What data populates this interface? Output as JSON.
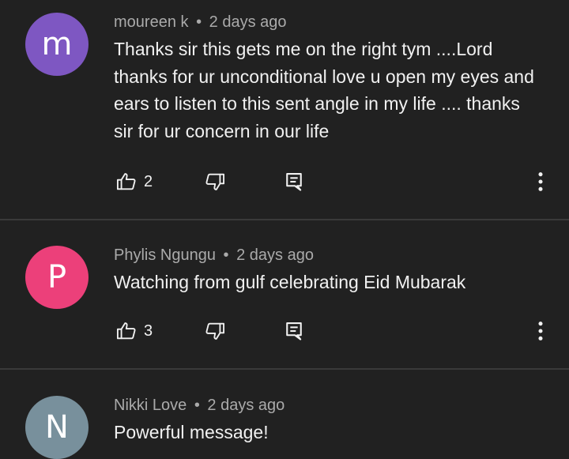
{
  "colors": {
    "background": "#212121",
    "meta_text": "#aaaaaa",
    "body_text": "#f1f1f1",
    "divider": "#3a3a3a"
  },
  "comments": [
    {
      "avatar_letter": "m",
      "avatar_color": "#7e57c2",
      "author": "moureen k",
      "separator": "•",
      "time": "2 days ago",
      "text": "Thanks sir this gets me on the right tym ....Lord thanks for ur unconditional love u open my eyes and ears to listen to this sent angle in my life .... thanks sir for ur concern in our life",
      "likes": "2",
      "icons": [
        "thumb-up-icon",
        "thumb-down-icon",
        "reply-icon",
        "more-vert-icon"
      ]
    },
    {
      "avatar_letter": "P",
      "avatar_color": "#ec407a",
      "author": "Phylis Ngungu",
      "separator": "•",
      "time": "2 days ago",
      "text": "Watching from gulf celebrating Eid Mubarak",
      "likes": "3",
      "icons": [
        "thumb-up-icon",
        "thumb-down-icon",
        "reply-icon",
        "more-vert-icon"
      ]
    },
    {
      "avatar_letter": "N",
      "avatar_color": "#78909c",
      "author": "Nikki Love",
      "separator": "•",
      "time": "2 days ago",
      "text": "Powerful message!"
    }
  ]
}
